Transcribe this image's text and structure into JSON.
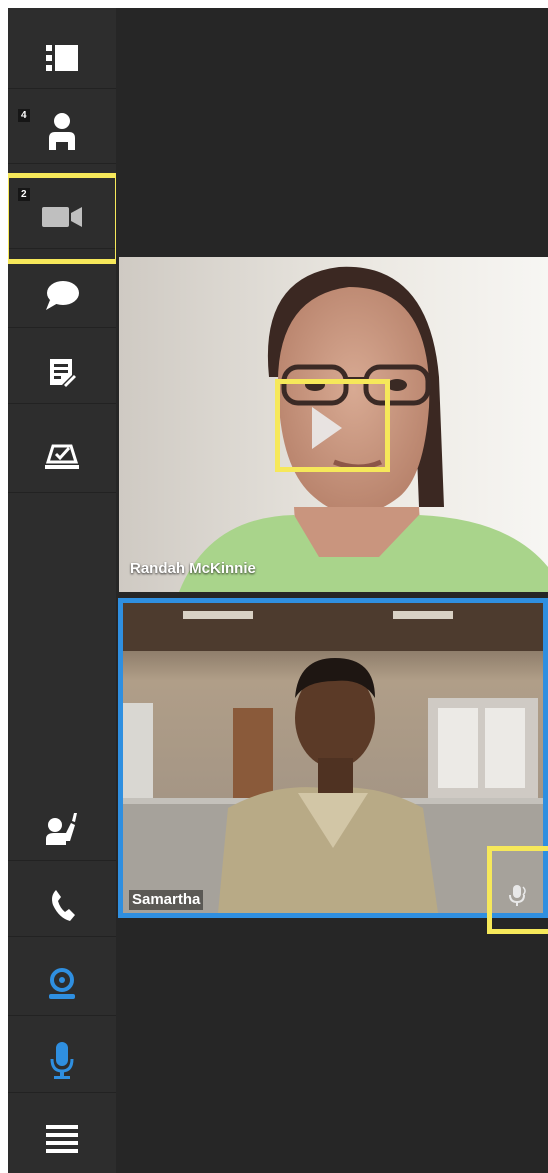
{
  "colors": {
    "sidebar_bg": "#2d2d2d",
    "main_bg": "#262626",
    "active_blue": "#2f8fe0",
    "highlight_yellow": "#f6e85a",
    "icon_white": "#ffffff"
  },
  "sidebar": {
    "top_items": [
      {
        "name": "layout-icon",
        "badge": ""
      },
      {
        "name": "participants-icon",
        "badge": "4"
      },
      {
        "name": "video-camera-icon",
        "badge": "2"
      },
      {
        "name": "chat-icon",
        "badge": ""
      },
      {
        "name": "notes-icon",
        "badge": ""
      },
      {
        "name": "poll-icon",
        "badge": ""
      }
    ],
    "bottom_items": [
      {
        "name": "raise-hand-icon"
      },
      {
        "name": "phone-icon"
      },
      {
        "name": "webcam-icon",
        "active": true
      },
      {
        "name": "microphone-icon",
        "active": true
      },
      {
        "name": "menu-icon"
      }
    ]
  },
  "videos": [
    {
      "name": "Randah McKinnie",
      "has_play_button": true,
      "active_speaker": false
    },
    {
      "name": "Samartha",
      "mic_icon": "microphone-icon",
      "active_speaker": true
    }
  ]
}
